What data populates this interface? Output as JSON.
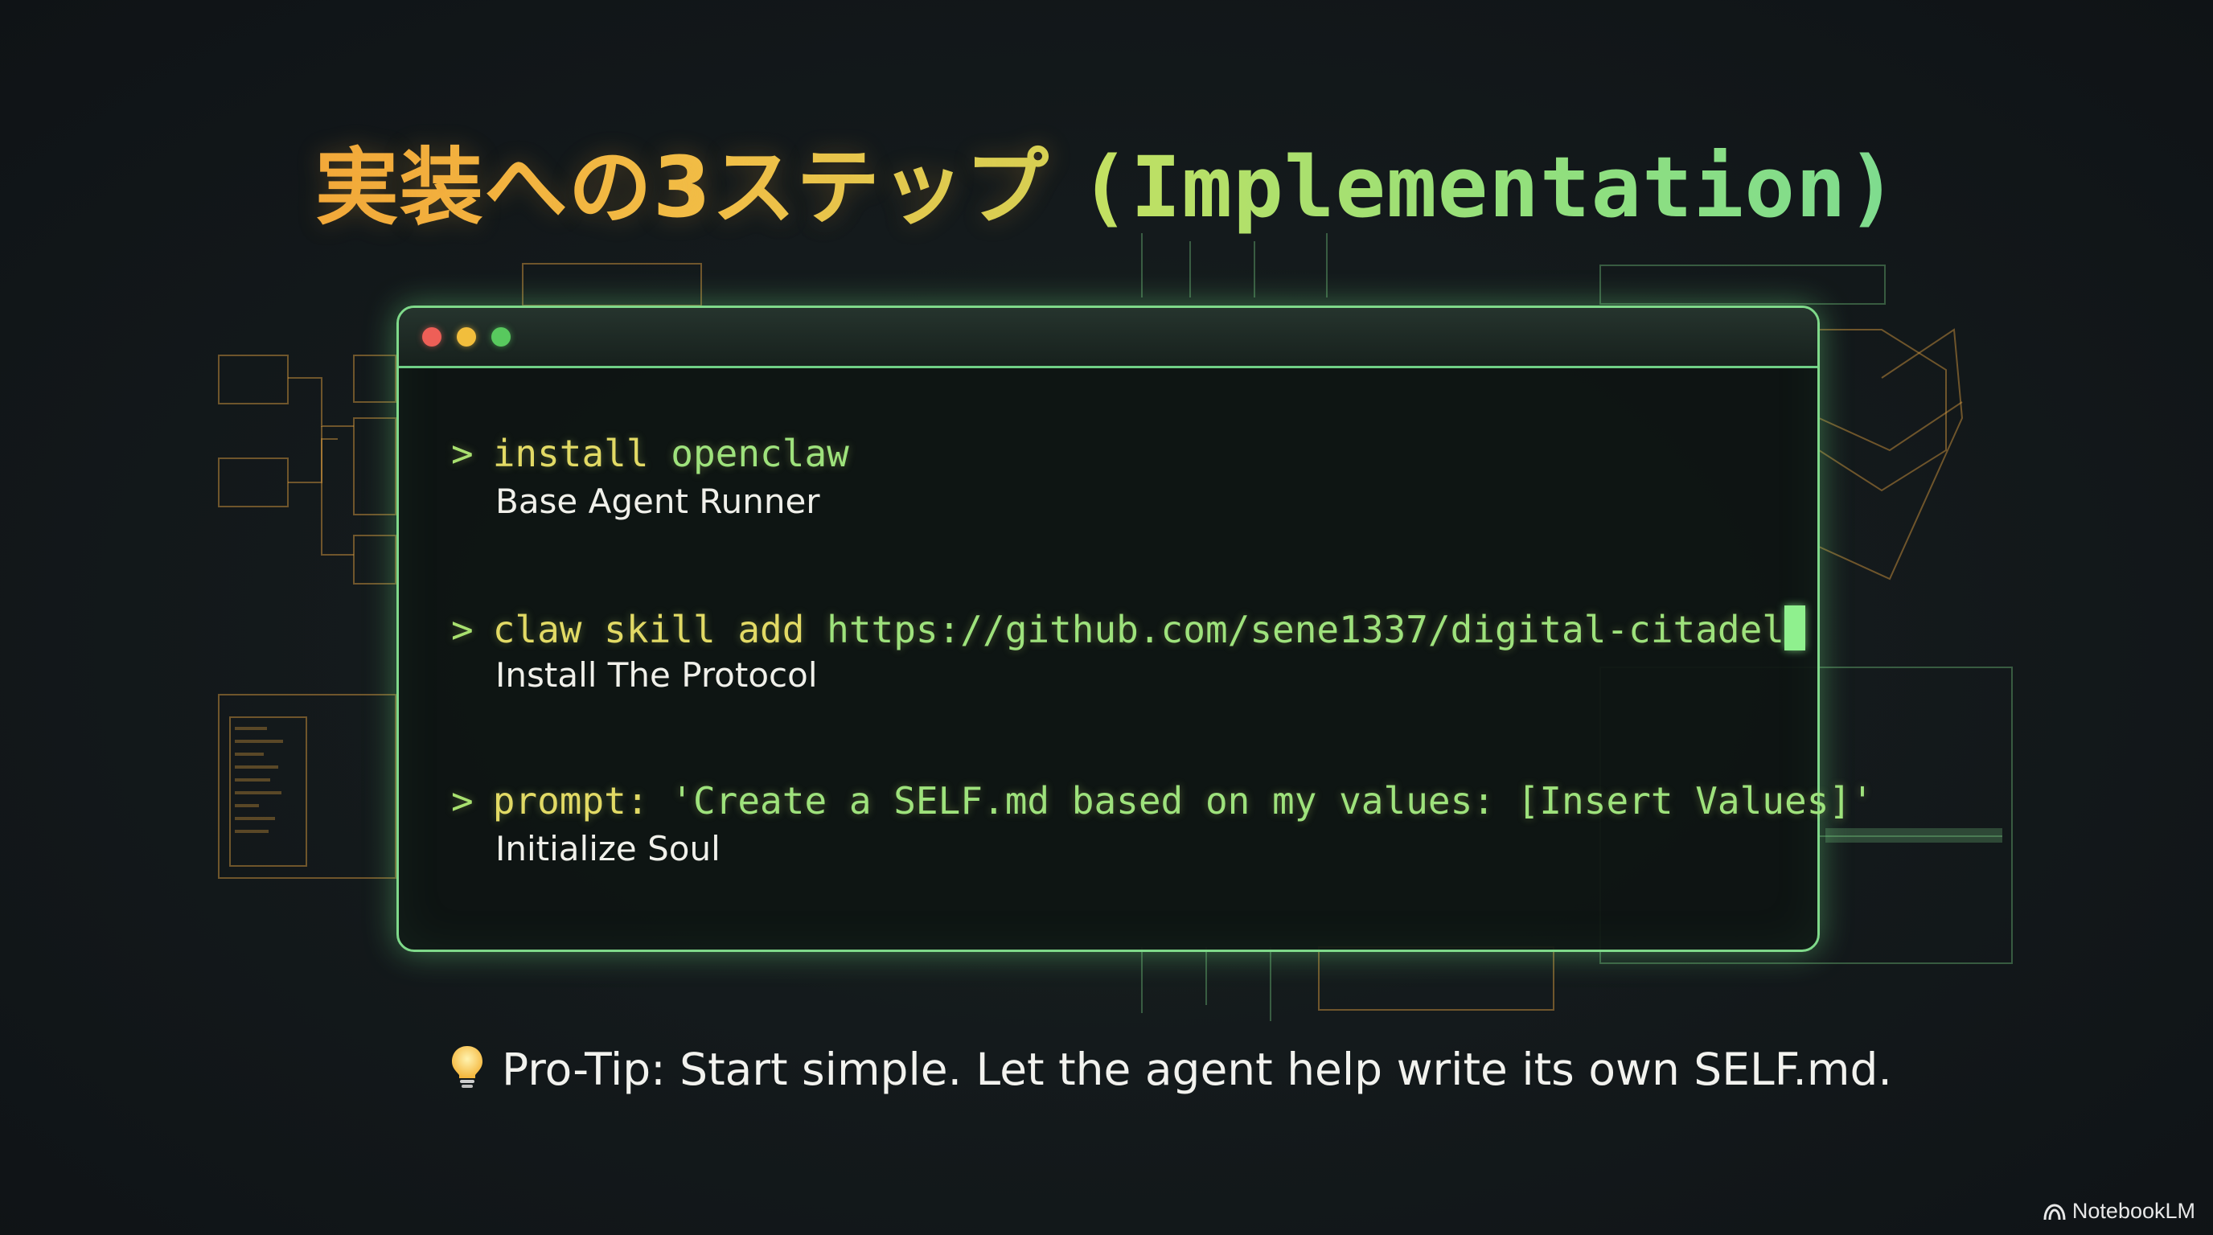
{
  "title": {
    "japanese": "実装への3ステップ",
    "english": "(Implementation)"
  },
  "terminal": {
    "steps": [
      {
        "prompt_char": ">",
        "keyword": "install",
        "argument": "openclaw",
        "description": "Base Agent Runner"
      },
      {
        "prompt_char": ">",
        "keyword": "claw skill add",
        "argument": "https://github.com/sene1337/digital-citadel",
        "description": "Install The Protocol"
      },
      {
        "prompt_char": ">",
        "keyword": "prompt:",
        "argument": "'Create a SELF.md based on my values: [Insert Values]'",
        "description": "Initialize Soul"
      }
    ]
  },
  "tip": {
    "icon": "lightbulb-icon",
    "text": "Pro-Tip: Start simple. Let the agent help write its own SELF.md."
  },
  "branding": {
    "name": "NotebookLM",
    "icon": "notebooklm-logo-icon"
  },
  "colors": {
    "accent_green": "#7fd98a",
    "accent_orange": "#f3a93a",
    "background": "#111519"
  }
}
